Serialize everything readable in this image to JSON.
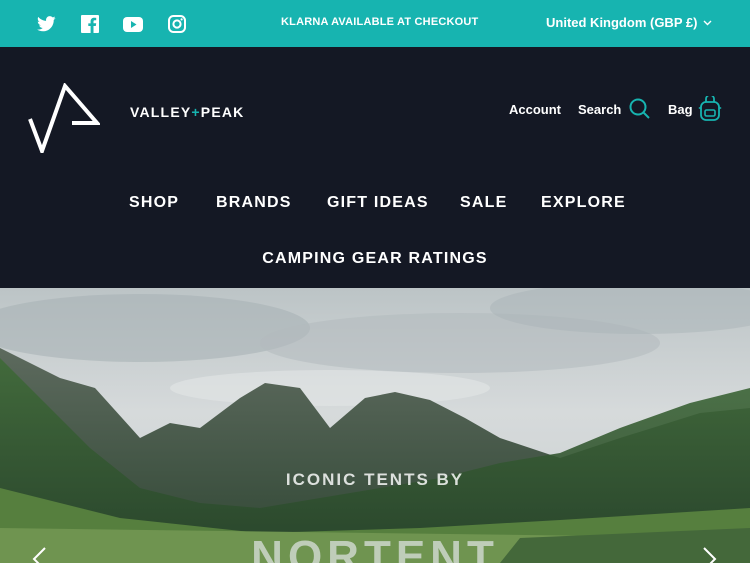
{
  "topbar": {
    "social": [
      "twitter-icon",
      "facebook-icon",
      "youtube-icon",
      "instagram-icon"
    ],
    "announcement": "KLARNA AVAILABLE AT CHECKOUT",
    "region": "United Kingdom (GBP £)",
    "background_color": "#17b4b0"
  },
  "header": {
    "brand_prefix": "VALLEY",
    "brand_plus": "+",
    "brand_suffix": "PEAK",
    "account_label": "Account",
    "search_label": "Search",
    "bag_label": "Bag",
    "background_color": "#141824",
    "accent_color": "#17b4b0"
  },
  "nav": {
    "items": [
      "SHOP",
      "BRANDS",
      "GIFT IDEAS",
      "SALE",
      "EXPLORE"
    ],
    "second_row": "CAMPING GEAR RATINGS"
  },
  "hero": {
    "title": "ICONIC TENTS BY",
    "brand": "NORTENT"
  }
}
